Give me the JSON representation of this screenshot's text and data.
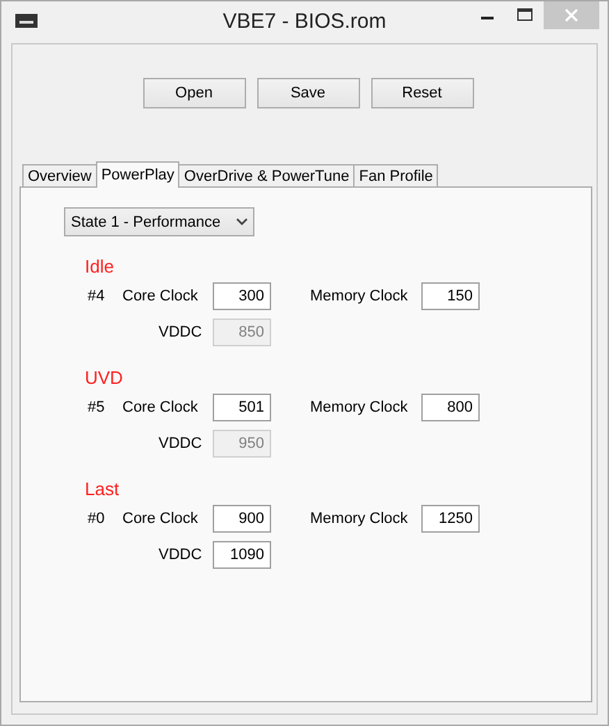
{
  "window": {
    "title": "VBE7 - BIOS.rom"
  },
  "buttons": [
    "Open",
    "Save",
    "Reset"
  ],
  "tabs": [
    {
      "label": "Overview",
      "selected": false
    },
    {
      "label": "PowerPlay",
      "selected": true
    },
    {
      "label": "OverDrive & PowerTune",
      "selected": false
    },
    {
      "label": "Fan Profile",
      "selected": false
    }
  ],
  "state_select": {
    "value": "State 1 - Performance"
  },
  "sections": [
    {
      "title": "Idle",
      "index": "#4",
      "core_clock_label": "Core Clock",
      "core_clock": "300",
      "memory_clock_label": "Memory Clock",
      "memory_clock": "150",
      "vddc_label": "VDDC",
      "vddc": "850",
      "vddc_disabled": true
    },
    {
      "title": "UVD",
      "index": "#5",
      "core_clock_label": "Core Clock",
      "core_clock": "501",
      "memory_clock_label": "Memory Clock",
      "memory_clock": "800",
      "vddc_label": "VDDC",
      "vddc": "950",
      "vddc_disabled": true
    },
    {
      "title": "Last",
      "index": "#0",
      "core_clock_label": "Core Clock",
      "core_clock": "900",
      "memory_clock_label": "Memory Clock",
      "memory_clock": "1250",
      "vddc_label": "VDDC",
      "vddc": "1090",
      "vddc_disabled": false
    }
  ]
}
